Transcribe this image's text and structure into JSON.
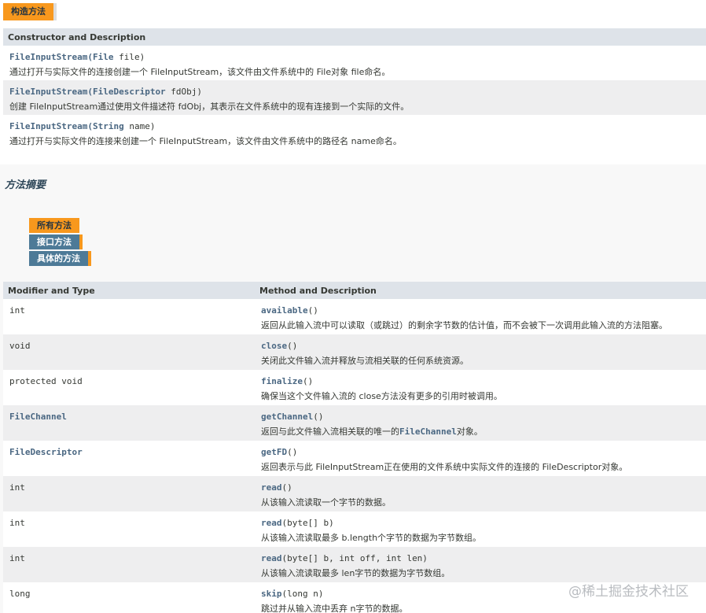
{
  "constructor_section": {
    "tab_label": "构造方法",
    "header": "Constructor and Description",
    "rows": [
      {
        "name": "FileInputStream",
        "open": "(",
        "param_type": "File",
        "param_rest": " file)",
        "desc": "通过打开与实际文件的连接创建一个 FileInputStream，该文件由文件系统中的 File对象 file命名。"
      },
      {
        "name": "FileInputStream",
        "open": "(",
        "param_type": "FileDescriptor",
        "param_rest": " fdObj)",
        "desc": "创建 FileInputStream通过使用文件描述符 fdObj，其表示在文件系统中的现有连接到一个实际的文件。"
      },
      {
        "name": "FileInputStream",
        "open": "(",
        "param_type": "String",
        "param_rest": " name)",
        "desc": "通过打开与实际文件的连接来创建一个 FileInputStream，该文件由文件系统中的路径名 name命名。"
      }
    ]
  },
  "method_section": {
    "title": "方法摘要",
    "tabs": [
      "所有方法",
      "接口方法",
      "具体的方法"
    ],
    "header_type": "Modifier and Type",
    "header_method": "Method and Description",
    "rows": [
      {
        "type": "int",
        "type_link": false,
        "method": "available",
        "args": "()",
        "desc": "返回从此输入流中可以读取（或跳过）的剩余字节数的估计值，而不会被下一次调用此输入流的方法阻塞。"
      },
      {
        "type": "void",
        "type_link": false,
        "method": "close",
        "args": "()",
        "desc": "关闭此文件输入流并释放与流相关联的任何系统资源。"
      },
      {
        "type": "protected void",
        "type_link": false,
        "method": "finalize",
        "args": "()",
        "desc": "确保当这个文件输入流的 close方法没有更多的引用时被调用。"
      },
      {
        "type": "FileChannel",
        "type_link": true,
        "method": "getChannel",
        "args": "()",
        "desc_pre": "返回与此文件输入流相关联的唯一的",
        "desc_link": "FileChannel",
        "desc_post": "对象。"
      },
      {
        "type": "FileDescriptor",
        "type_link": true,
        "method": "getFD",
        "args": "()",
        "desc": "返回表示与此 FileInputStream正在使用的文件系统中实际文件的连接的 FileDescriptor对象。"
      },
      {
        "type": "int",
        "type_link": false,
        "method": "read",
        "args": "()",
        "desc": "从该输入流读取一个字节的数据。"
      },
      {
        "type": "int",
        "type_link": false,
        "method": "read",
        "args": "(byte[] b)",
        "desc": "从该输入流读取最多 b.length个字节的数据为字节数组。"
      },
      {
        "type": "int",
        "type_link": false,
        "method": "read",
        "args": "(byte[] b, int off, int len)",
        "desc": "从该输入流读取最多 len字节的数据为字节数组。"
      },
      {
        "type": "long",
        "type_link": false,
        "method": "skip",
        "args": "(long n)",
        "desc": "跳过并从输入流中丢弃 n字节的数据。"
      }
    ]
  },
  "watermark": "@稀土掘金技术社区"
}
